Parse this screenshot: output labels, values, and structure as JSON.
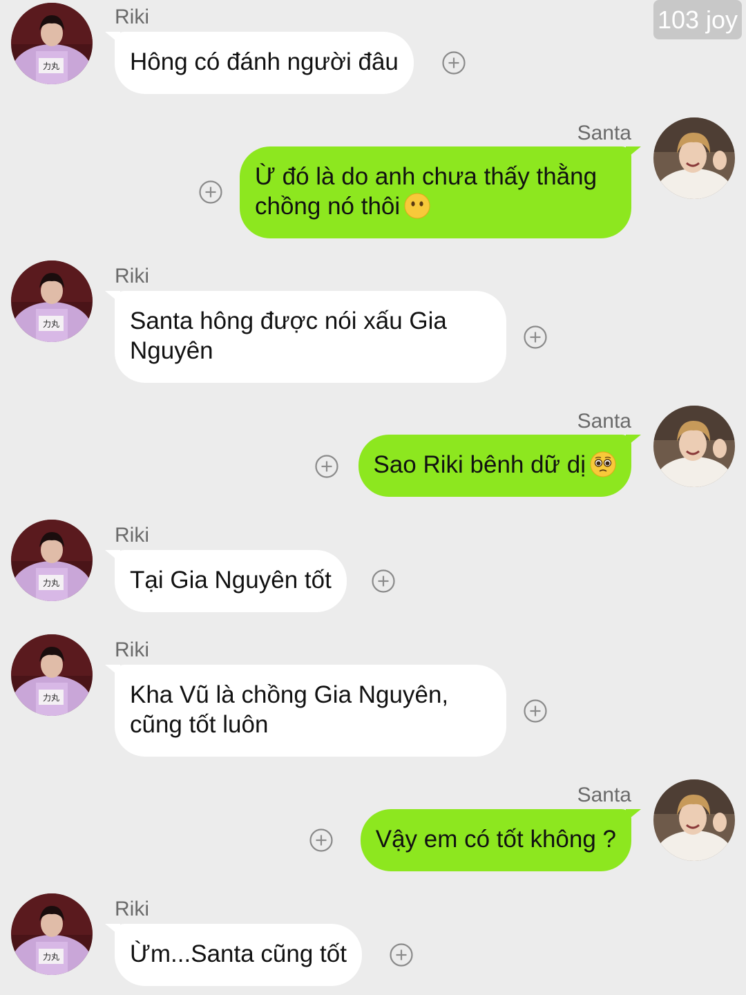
{
  "watermark": "103 joy",
  "icons": {
    "add": "plus-circle-icon",
    "emoji_neutral": "face-without-mouth-emoji",
    "emoji_pleading": "pleading-face-emoji"
  },
  "colors": {
    "background": "#ececec",
    "incoming_bubble": "#ffffff",
    "outgoing_bubble": "#8de71f",
    "watermark_bg": "#c8c8c8"
  },
  "messages": [
    {
      "sender": "Riki",
      "side": "left",
      "text": "Hông có đánh người đâu"
    },
    {
      "sender": "Santa",
      "side": "right",
      "text": "Ừ đó là do anh chưa thấy thằng chồng nó thôi",
      "emoji": "face-without-mouth-emoji"
    },
    {
      "sender": "Riki",
      "side": "left",
      "text": "Santa hông được nói xấu Gia Nguyên"
    },
    {
      "sender": "Santa",
      "side": "right",
      "text": "Sao Riki bênh dữ dị",
      "emoji": "pleading-face-emoji"
    },
    {
      "sender": "Riki",
      "side": "left",
      "text": "Tại Gia Nguyên tốt"
    },
    {
      "sender": "Riki",
      "side": "left",
      "text": "Kha Vũ là chồng Gia Nguyên, cũng tốt luôn"
    },
    {
      "sender": "Santa",
      "side": "right",
      "text": "Vậy em có tốt không ?"
    },
    {
      "sender": "Riki",
      "side": "left",
      "text": "Ừm...Santa cũng tốt"
    }
  ]
}
